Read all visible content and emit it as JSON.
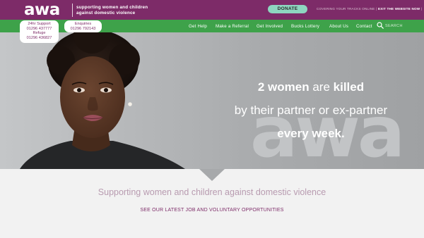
{
  "header": {
    "logo": "awa",
    "tagline_line1": "supporting women and children",
    "tagline_line2": "against domestic violence",
    "donate_label": "DONATE",
    "covering_text": "COVERING YOUR TRACKS ONLINE",
    "separator": "|",
    "exit_label": "EXIT THE WEBSITE NOW",
    "exit_separator": "|"
  },
  "nav": {
    "items": [
      {
        "label": "Get Help"
      },
      {
        "label": "Make a Referral"
      },
      {
        "label": "Get Involved"
      },
      {
        "label": "Bucks Lottery"
      },
      {
        "label": "About Us"
      },
      {
        "label": "Contact"
      }
    ],
    "search_placeholder": "SEARCH"
  },
  "contacts": {
    "support_label": "24hr Support",
    "support_number": "01296 437777",
    "refuge_label": "Refuge",
    "refuge_number": "01296 436827",
    "enquiries_label": "Enquiries",
    "enquiries_number": "01296 792143"
  },
  "hero": {
    "line1_a": "2 women",
    "line1_b": " are ",
    "line1_c": "killed",
    "line2": "by their partner or ex-partner",
    "line3": "every week.",
    "watermark": "awa"
  },
  "content": {
    "support_text": "Supporting women and children against domestic violence",
    "jobs_link": "SEE OUR LATEST JOB AND VOLUNTARY OPPORTUNITIES"
  },
  "colors": {
    "brand_purple": "#7d2b68",
    "nav_green": "#3ea24a",
    "donate_mint": "#8ed6c0"
  }
}
